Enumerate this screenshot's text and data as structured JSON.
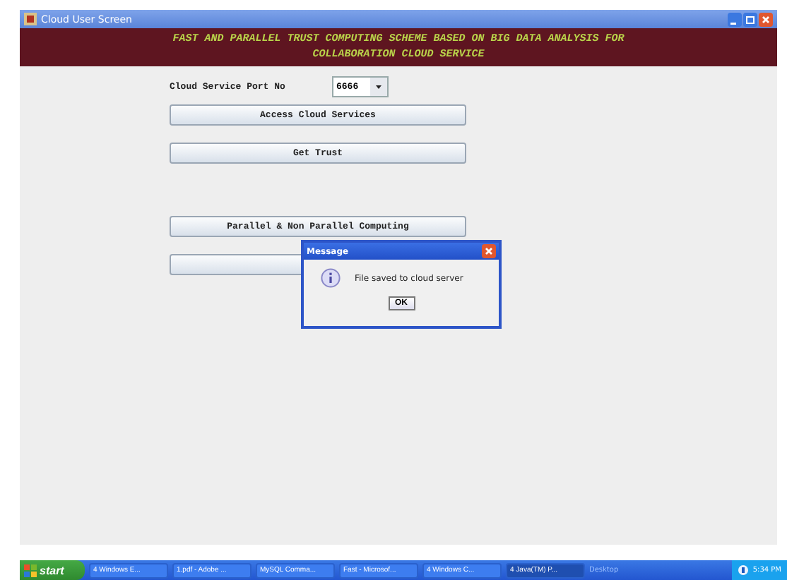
{
  "window": {
    "title": "Cloud User Screen"
  },
  "header": {
    "title": "FAST AND PARALLEL TRUST COMPUTING SCHEME BASED ON BIG DATA ANALYSIS FOR COLLABORATION CLOUD SERVICE"
  },
  "port": {
    "label": "Cloud Service Port No",
    "value": "6666"
  },
  "buttons": [
    {
      "label": "Access Cloud Services",
      "kind": "gap-none"
    },
    {
      "label": "Get Trust",
      "kind": "gap-large"
    },
    {
      "label": "Parallel & Non Parallel Computing",
      "kind": "gap-none"
    },
    {
      "kind": "hidden"
    }
  ],
  "dialog": {
    "title": "Message",
    "message": "File saved to cloud server",
    "button": "OK"
  },
  "taskbar": {
    "start": "start",
    "items": [
      {
        "label": "4 Windows E...",
        "selected": false
      },
      {
        "label": "1.pdf - Adobe ...",
        "selected": false
      },
      {
        "label": "MySQL Comma...",
        "selected": false
      },
      {
        "label": "Fast - Microsof...",
        "selected": false
      },
      {
        "label": "4 Windows C...",
        "selected": false
      },
      {
        "label": "4 Java(TM) P...",
        "selected": true
      }
    ],
    "desktop": "Desktop",
    "time": "5:34 PM"
  }
}
